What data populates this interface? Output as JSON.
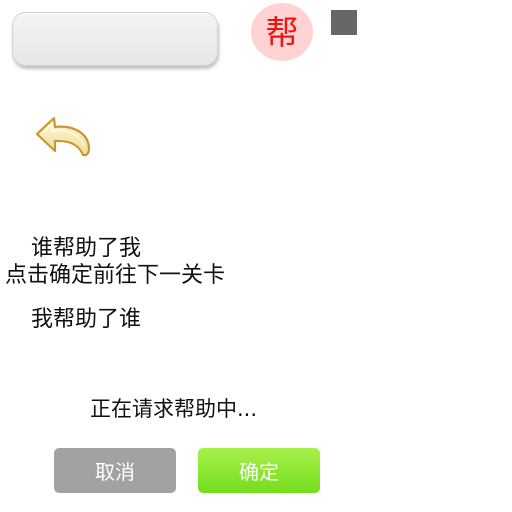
{
  "header": {
    "help_badge_char": "帮"
  },
  "content": {
    "who_helped_me": "谁帮助了我",
    "click_confirm_next": "点击确定前往下一关卡",
    "i_helped_whom": "我帮助了谁",
    "requesting_help": "正在请求帮助中..."
  },
  "buttons": {
    "cancel_label": "取消",
    "confirm_label": "确定"
  },
  "icons": {
    "back": "back-arrow-icon"
  },
  "colors": {
    "badge_background": "#ffd3d3",
    "badge_text": "#ee1515",
    "cancel_button": "#a2a2a2",
    "confirm_button": "#73de1c",
    "square": "#666666"
  }
}
